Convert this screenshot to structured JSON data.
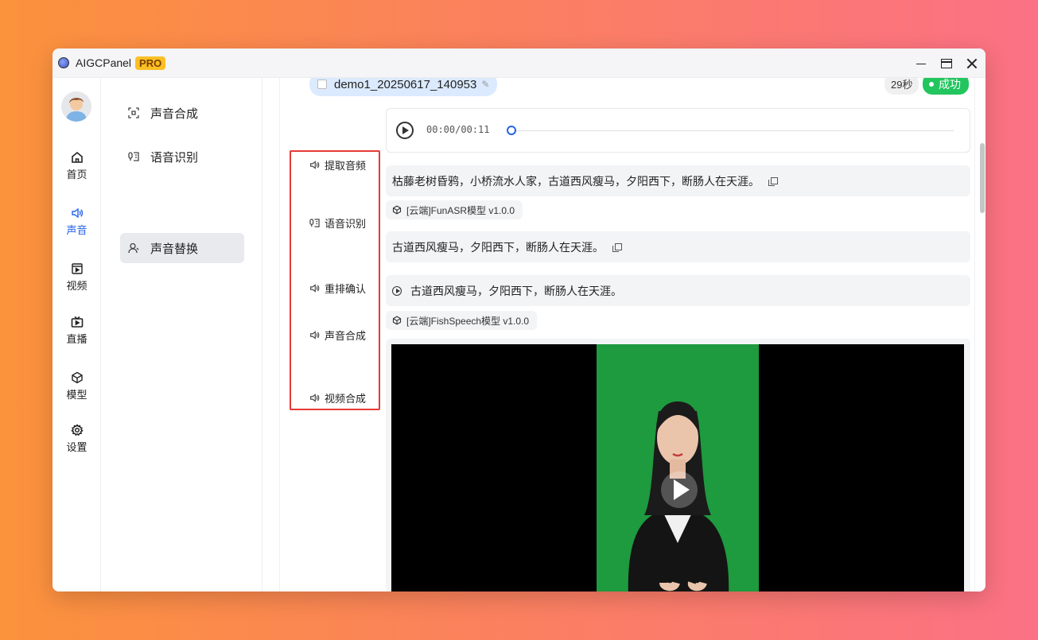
{
  "window": {
    "app_title": "AIGCPanel",
    "pro_badge": "PRO"
  },
  "rail": {
    "items": [
      {
        "label": "首页",
        "icon": "home-icon"
      },
      {
        "label": "声音",
        "icon": "speaker-icon",
        "active": true
      },
      {
        "label": "视频",
        "icon": "video-icon"
      },
      {
        "label": "直播",
        "icon": "tv-icon"
      },
      {
        "label": "模型",
        "icon": "cube-icon"
      },
      {
        "label": "设置",
        "icon": "gear-icon"
      }
    ]
  },
  "submenu": {
    "items": [
      {
        "label": "声音合成",
        "icon": "scan-icon"
      },
      {
        "label": "语音识别",
        "icon": "mic-text-icon"
      },
      {
        "label": "声音替换",
        "icon": "person-icon",
        "active": true
      }
    ]
  },
  "task": {
    "file_name": "demo1_20250617_140953",
    "duration": "29秒",
    "status": "成功"
  },
  "steps": [
    {
      "label": "提取音频"
    },
    {
      "label": "语音识别"
    },
    {
      "label": "重排确认"
    },
    {
      "label": "声音合成"
    },
    {
      "label": "视频合成"
    }
  ],
  "audio": {
    "time": "00:00/00:11",
    "progress": 0
  },
  "recognized_text": "枯藤老树昏鸦，小桥流水人家，古道西风瘦马，夕阳西下，断肠人在天涯。",
  "asr_model": "[云端]FunASR模型 v1.0.0",
  "confirmed_text": "古道西风瘦马，夕阳西下，断肠人在天涯。",
  "synth_text": "古道西风瘦马，夕阳西下，断肠人在天涯。",
  "tts_model": "[云端]FishSpeech模型 v1.0.0",
  "colors": {
    "accent": "#2563eb",
    "success": "#22c55e",
    "highlight": "#e53935",
    "pro": "#fbbf24"
  }
}
